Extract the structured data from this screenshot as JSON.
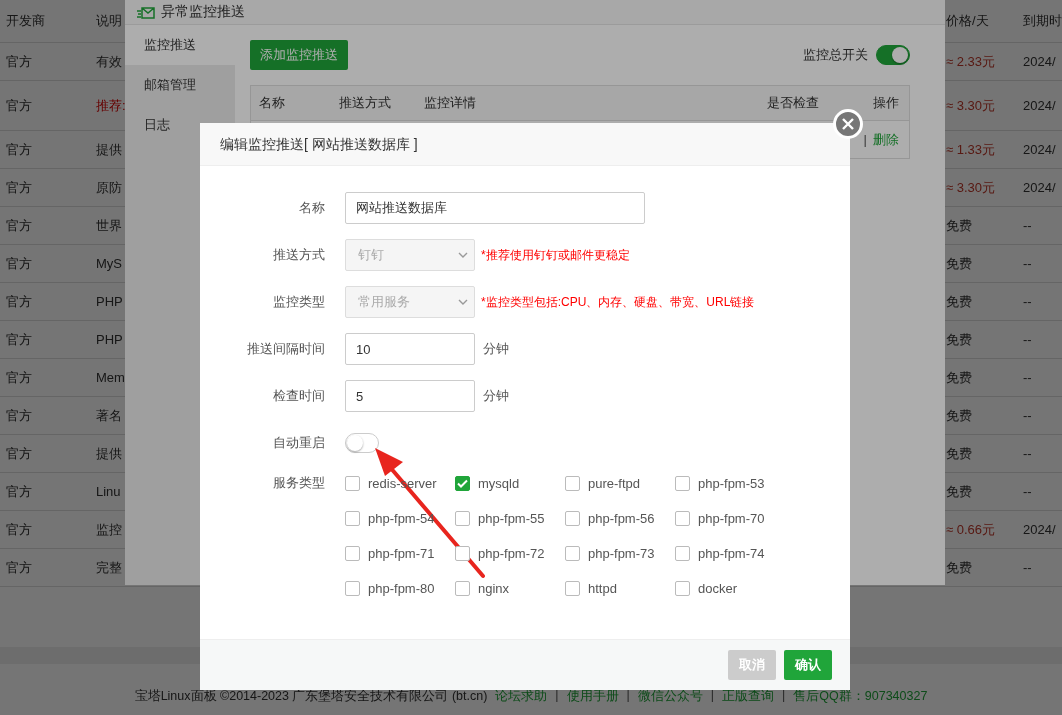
{
  "page": {
    "table": {
      "columns": [
        "开发商",
        "说明",
        "价格/天",
        "到期时"
      ],
      "rows": [
        {
          "developer": "官方",
          "description": "有效",
          "recommended": false,
          "price": "≈ 2.33元",
          "paid": true,
          "expiry": "2024/"
        },
        {
          "developer": "官方",
          "description": "推荐:",
          "recommended": true,
          "price": "≈ 3.30元",
          "paid": true,
          "expiry": "2024/"
        },
        {
          "developer": "官方",
          "description": "提供",
          "recommended": false,
          "price": "≈ 1.33元",
          "paid": true,
          "expiry": "2024/"
        },
        {
          "developer": "官方",
          "description": "原防",
          "recommended": false,
          "price": "≈ 3.30元",
          "paid": true,
          "expiry": "2024/"
        },
        {
          "developer": "官方",
          "description": "世界",
          "recommended": false,
          "price": "免费",
          "paid": false,
          "expiry": "--"
        },
        {
          "developer": "官方",
          "description": "MyS",
          "recommended": false,
          "price": "免费",
          "paid": false,
          "expiry": "--"
        },
        {
          "developer": "官方",
          "description": "PHP",
          "recommended": false,
          "price": "免费",
          "paid": false,
          "expiry": "--"
        },
        {
          "developer": "官方",
          "description": "PHP",
          "recommended": false,
          "price": "免费",
          "paid": false,
          "expiry": "--"
        },
        {
          "developer": "官方",
          "description": "Mem",
          "recommended": false,
          "price": "免费",
          "paid": false,
          "expiry": "--"
        },
        {
          "developer": "官方",
          "description": "著名",
          "recommended": false,
          "price": "免费",
          "paid": false,
          "expiry": "--"
        },
        {
          "developer": "官方",
          "description": "提供",
          "recommended": false,
          "price": "免费",
          "paid": false,
          "expiry": "--"
        },
        {
          "developer": "官方",
          "description": "Linu",
          "recommended": false,
          "price": "免费",
          "paid": false,
          "expiry": "--"
        },
        {
          "developer": "官方",
          "description": "监控",
          "recommended": false,
          "price": "≈ 0.66元",
          "paid": true,
          "expiry": "2024/"
        },
        {
          "developer": "官方",
          "description": "完整",
          "recommended": false,
          "price": "免费",
          "paid": false,
          "expiry": "--"
        }
      ]
    },
    "footer": {
      "copyright": "宝塔Linux面板 ©2014-2023 广东堡塔安全技术有限公司 (bt.cn)",
      "items": [
        {
          "kind": "link",
          "text": "论坛求助"
        },
        {
          "kind": "separator",
          "text": "|"
        },
        {
          "kind": "link",
          "text": "使用手册"
        },
        {
          "kind": "separator",
          "text": "|"
        },
        {
          "kind": "link",
          "text": "微信公众号"
        },
        {
          "kind": "separator",
          "text": "|"
        },
        {
          "kind": "link",
          "text": "正版查询"
        },
        {
          "kind": "separator",
          "text": "|"
        },
        {
          "kind": "link",
          "text": "售后QQ群：907340327"
        }
      ]
    }
  },
  "plugin_window": {
    "title": "异常监控推送",
    "menu": [
      {
        "label": "监控推送",
        "selected": true
      },
      {
        "label": "邮箱管理",
        "selected": false
      },
      {
        "label": "日志",
        "selected": false
      }
    ],
    "add_button": "添加监控推送",
    "master_switch": {
      "label": "监控总开关",
      "on": true
    },
    "table": {
      "columns": [
        "名称",
        "推送方式",
        "监控详情",
        "是否检查",
        "操作"
      ],
      "rows": [
        {
          "separator": "|",
          "delete": "删除"
        }
      ]
    }
  },
  "dialog": {
    "title": "编辑监控推送[ 网站推送数据库 ]",
    "fields": [
      {
        "kind": "text",
        "label": "名称",
        "value": "网站推送数据库"
      },
      {
        "kind": "select",
        "label": "推送方式",
        "value": "钉钉",
        "disabled": true,
        "hint": "*推荐使用钉钉或邮件更稳定"
      },
      {
        "kind": "select",
        "label": "监控类型",
        "value": "常用服务",
        "disabled": true,
        "hint": "*监控类型包括:CPU、内存、硬盘、带宽、URL链接"
      },
      {
        "kind": "number",
        "label": "推送间隔时间",
        "value": "10",
        "unit": "分钟"
      },
      {
        "kind": "number",
        "label": "检查时间",
        "value": "5",
        "unit": "分钟"
      },
      {
        "kind": "toggle",
        "label": "自动重启",
        "on": false
      }
    ],
    "services": {
      "label": "服务类型",
      "items": [
        {
          "name": "redis-server",
          "checked": false
        },
        {
          "name": "mysqld",
          "checked": true
        },
        {
          "name": "pure-ftpd",
          "checked": false
        },
        {
          "name": "php-fpm-53",
          "checked": false
        },
        {
          "name": "php-fpm-54",
          "checked": false
        },
        {
          "name": "php-fpm-55",
          "checked": false
        },
        {
          "name": "php-fpm-56",
          "checked": false
        },
        {
          "name": "php-fpm-70",
          "checked": false
        },
        {
          "name": "php-fpm-71",
          "checked": false
        },
        {
          "name": "php-fpm-72",
          "checked": false
        },
        {
          "name": "php-fpm-73",
          "checked": false
        },
        {
          "name": "php-fpm-74",
          "checked": false
        },
        {
          "name": "php-fpm-80",
          "checked": false
        },
        {
          "name": "nginx",
          "checked": false
        },
        {
          "name": "httpd",
          "checked": false
        },
        {
          "name": "docker",
          "checked": false
        }
      ]
    },
    "buttons": [
      {
        "kind": "cancel",
        "label": "取消"
      },
      {
        "kind": "confirm",
        "label": "确认"
      }
    ]
  }
}
